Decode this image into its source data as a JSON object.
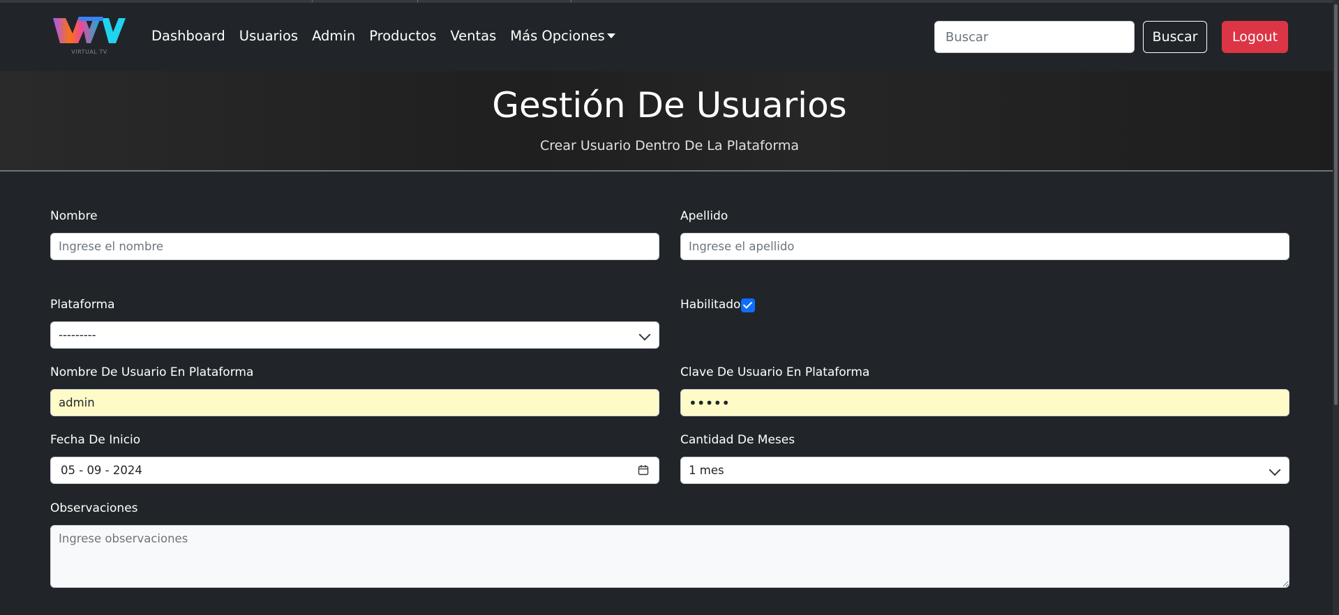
{
  "navbar": {
    "logo_text": "VIRTUAL TV",
    "links": [
      "Dashboard",
      "Usuarios",
      "Admin",
      "Productos",
      "Ventas"
    ],
    "more_options": "Más Opciones",
    "search_placeholder": "Buscar",
    "search_button": "Buscar",
    "logout_button": "Logout"
  },
  "hero": {
    "title": "Gestión De Usuarios",
    "subtitle": "Crear Usuario Dentro De La Plataforma"
  },
  "form": {
    "nombre": {
      "label": "Nombre",
      "placeholder": "Ingrese el nombre"
    },
    "apellido": {
      "label": "Apellido",
      "placeholder": "Ingrese el apellido"
    },
    "plataforma": {
      "label": "Plataforma",
      "value": "---------"
    },
    "habilitado": {
      "label": "Habilitado",
      "checked": true
    },
    "usuario_plataforma": {
      "label": "Nombre De Usuario En Plataforma",
      "value": "admin"
    },
    "clave_plataforma": {
      "label": "Clave De Usuario En Plataforma",
      "value": "admin"
    },
    "fecha_inicio": {
      "label": "Fecha De Inicio",
      "value": "05 - 09 - 2024"
    },
    "cantidad_meses": {
      "label": "Cantidad De Meses",
      "value": "1 mes"
    },
    "observaciones": {
      "label": "Observaciones",
      "placeholder": "Ingrese observaciones"
    }
  },
  "colors": {
    "background": "#212529",
    "logout": "#dc3545",
    "checkbox": "#0d6efd",
    "autofill": "#fffbc8"
  }
}
